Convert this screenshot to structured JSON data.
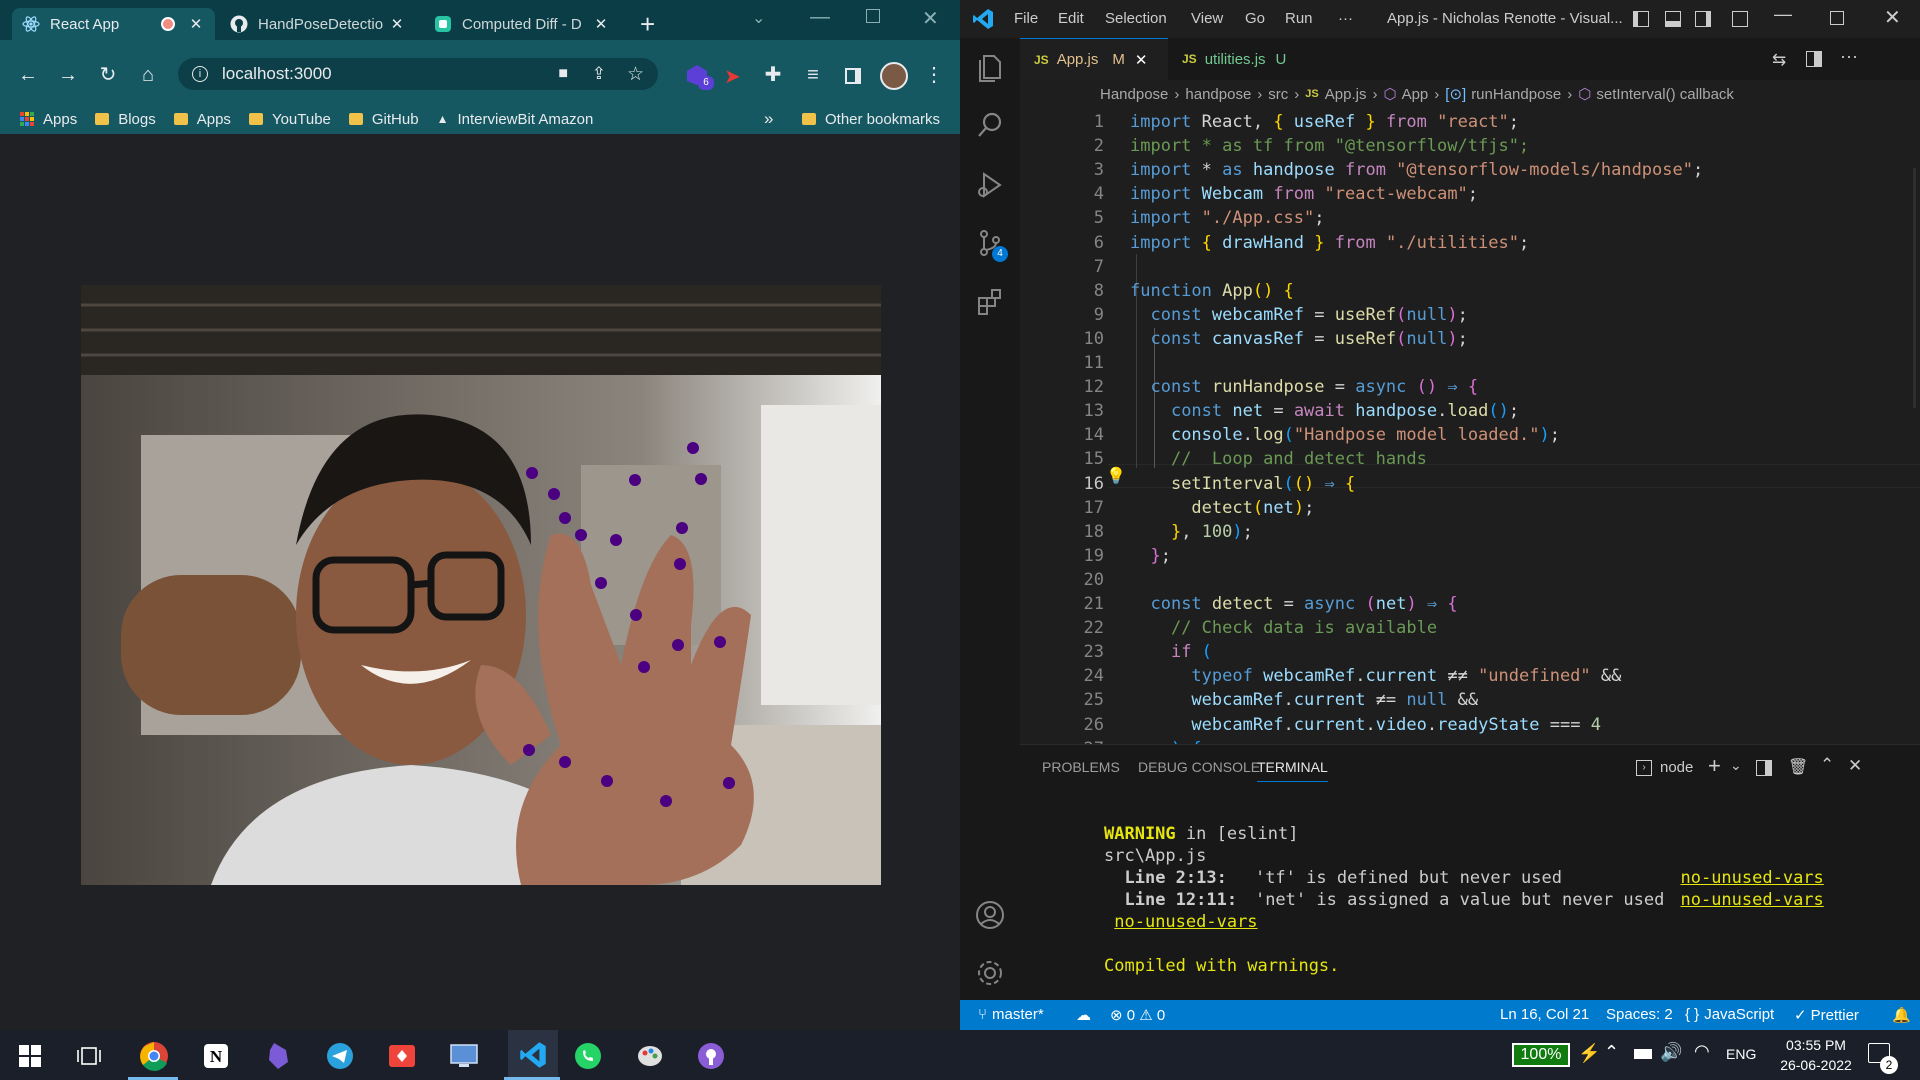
{
  "chrome": {
    "tabs": [
      {
        "label": "React App",
        "active": true
      },
      {
        "label": "HandPoseDetectio",
        "active": false
      },
      {
        "label": "Computed Diff - D",
        "active": false
      }
    ],
    "new_tab": "+",
    "address": "localhost:3000",
    "profile_badge": "6",
    "bookmarks": [
      "Apps",
      "Blogs",
      "Apps",
      "YouTube",
      "GitHub",
      "InterviewBit Amazon"
    ],
    "bookmarks_more": "»",
    "other_bookmarks": "Other bookmarks",
    "hand_keypoint_count": 21
  },
  "vscode": {
    "menu": [
      "File",
      "Edit",
      "Selection",
      "View",
      "Go",
      "Run",
      "···"
    ],
    "title": "App.js - Nicholas Renotte - Visual...",
    "tabs": [
      {
        "icon": "JS",
        "label": "App.js",
        "status": "M",
        "active": true
      },
      {
        "icon": "JS",
        "label": "utilities.js",
        "status": "U",
        "active": false
      }
    ],
    "breadcrumb": [
      "Handpose",
      "handpose",
      "src",
      "App.js",
      "App",
      "runHandpose",
      "setInterval() callback"
    ],
    "breadcrumb_js": "JS",
    "source_control_badge": "4",
    "code_lines": [
      [
        [
          "k",
          "import "
        ],
        [
          "w",
          "React, "
        ],
        [
          "y",
          "{"
        ],
        [
          "v",
          " useRef "
        ],
        [
          "y",
          "}"
        ],
        [
          "c",
          " from "
        ],
        [
          "s",
          "\"react\""
        ],
        [
          "w",
          ";"
        ]
      ],
      [
        [
          "g",
          "import * as tf from \"@tensorflow/tfjs\";"
        ]
      ],
      [
        [
          "k",
          "import "
        ],
        [
          "w",
          "* "
        ],
        [
          "k",
          "as "
        ],
        [
          "v",
          "handpose "
        ],
        [
          "c",
          "from "
        ],
        [
          "s",
          "\"@tensorflow-models/handpose\""
        ],
        [
          "w",
          ";"
        ]
      ],
      [
        [
          "k",
          "import "
        ],
        [
          "v",
          "Webcam "
        ],
        [
          "c",
          "from "
        ],
        [
          "s",
          "\"react-webcam\""
        ],
        [
          "w",
          ";"
        ]
      ],
      [
        [
          "k",
          "import "
        ],
        [
          "s",
          "\"./App.css\""
        ],
        [
          "w",
          ";"
        ]
      ],
      [
        [
          "k",
          "import "
        ],
        [
          "y",
          "{"
        ],
        [
          "v",
          " drawHand "
        ],
        [
          "y",
          "}"
        ],
        [
          "c",
          " from "
        ],
        [
          "s",
          "\"./utilities\""
        ],
        [
          "w",
          ";"
        ]
      ],
      [],
      [
        [
          "k",
          "function "
        ],
        [
          "f",
          "App"
        ],
        [
          "y",
          "() {"
        ]
      ],
      [
        [
          "w",
          "  "
        ],
        [
          "k",
          "const "
        ],
        [
          "v",
          "webcamRef "
        ],
        [
          "w",
          "= "
        ],
        [
          "f",
          "useRef"
        ],
        [
          "p",
          "("
        ],
        [
          "k",
          "null"
        ],
        [
          "p",
          ")"
        ],
        [
          "w",
          ";"
        ]
      ],
      [
        [
          "w",
          "  "
        ],
        [
          "k",
          "const "
        ],
        [
          "v",
          "canvasRef "
        ],
        [
          "w",
          "= "
        ],
        [
          "f",
          "useRef"
        ],
        [
          "p",
          "("
        ],
        [
          "k",
          "null"
        ],
        [
          "p",
          ")"
        ],
        [
          "w",
          ";"
        ]
      ],
      [],
      [
        [
          "w",
          "  "
        ],
        [
          "k",
          "const "
        ],
        [
          "f",
          "runHandpose "
        ],
        [
          "w",
          "= "
        ],
        [
          "k",
          "async "
        ],
        [
          "p",
          "() "
        ],
        [
          "k",
          "⇒ "
        ],
        [
          "p",
          "{"
        ]
      ],
      [
        [
          "w",
          "    "
        ],
        [
          "k",
          "const "
        ],
        [
          "v",
          "net "
        ],
        [
          "w",
          "= "
        ],
        [
          "c",
          "await "
        ],
        [
          "v",
          "handpose"
        ],
        [
          "w",
          "."
        ],
        [
          "f",
          "load"
        ],
        [
          "b",
          "()"
        ],
        [
          "w",
          ";"
        ]
      ],
      [
        [
          "w",
          "    "
        ],
        [
          "v",
          "console"
        ],
        [
          "w",
          "."
        ],
        [
          "f",
          "log"
        ],
        [
          "b",
          "("
        ],
        [
          "s",
          "\"Handpose model loaded.\""
        ],
        [
          "b",
          ")"
        ],
        [
          "w",
          ";"
        ]
      ],
      [
        [
          "w",
          "    "
        ],
        [
          "g",
          "//  Loop and detect hands"
        ]
      ],
      [
        [
          "w",
          "    "
        ],
        [
          "f",
          "setInterval"
        ],
        [
          "b",
          "("
        ],
        [
          "y",
          "() "
        ],
        [
          "k",
          "⇒ "
        ],
        [
          "y",
          "{"
        ]
      ],
      [
        [
          "w",
          "      "
        ],
        [
          "f",
          "detect"
        ],
        [
          "y",
          "("
        ],
        [
          "v",
          "net"
        ],
        [
          "y",
          ")"
        ],
        [
          "w",
          ";"
        ]
      ],
      [
        [
          "w",
          "    "
        ],
        [
          "y",
          "}"
        ],
        [
          "w",
          ", "
        ],
        [
          "n",
          "100"
        ],
        [
          "b",
          ")"
        ],
        [
          "w",
          ";"
        ]
      ],
      [
        [
          "w",
          "  "
        ],
        [
          "p",
          "}"
        ],
        [
          "w",
          ";"
        ]
      ],
      [],
      [
        [
          "w",
          "  "
        ],
        [
          "k",
          "const "
        ],
        [
          "f",
          "detect "
        ],
        [
          "w",
          "= "
        ],
        [
          "k",
          "async "
        ],
        [
          "p",
          "("
        ],
        [
          "v",
          "net"
        ],
        [
          "p",
          ") "
        ],
        [
          "k",
          "⇒ "
        ],
        [
          "p",
          "{"
        ]
      ],
      [
        [
          "w",
          "    "
        ],
        [
          "g",
          "// Check data is available"
        ]
      ],
      [
        [
          "w",
          "    "
        ],
        [
          "c",
          "if "
        ],
        [
          "b",
          "("
        ]
      ],
      [
        [
          "w",
          "      "
        ],
        [
          "k",
          "typeof "
        ],
        [
          "v",
          "webcamRef"
        ],
        [
          "w",
          "."
        ],
        [
          "v",
          "current "
        ],
        [
          "w",
          "≠≠ "
        ],
        [
          "s",
          "\"undefined\" "
        ],
        [
          "w",
          "&&"
        ]
      ],
      [
        [
          "w",
          "      "
        ],
        [
          "v",
          "webcamRef"
        ],
        [
          "w",
          "."
        ],
        [
          "v",
          "current "
        ],
        [
          "w",
          "≠= "
        ],
        [
          "k",
          "null "
        ],
        [
          "w",
          "&&"
        ]
      ],
      [
        [
          "w",
          "      "
        ],
        [
          "v",
          "webcamRef"
        ],
        [
          "w",
          "."
        ],
        [
          "v",
          "current"
        ],
        [
          "w",
          "."
        ],
        [
          "v",
          "video"
        ],
        [
          "w",
          "."
        ],
        [
          "v",
          "readyState "
        ],
        [
          "w",
          "=== "
        ],
        [
          "n",
          "4"
        ]
      ],
      [
        [
          "w",
          "    "
        ],
        [
          "b",
          ") {"
        ]
      ]
    ],
    "panel_tabs": [
      "PROBLEMS",
      "DEBUG CONSOLE",
      "TERMINAL"
    ],
    "terminal_shell": "node",
    "terminal": {
      "warning_label": "WARNING",
      "warning_rest": " in [eslint]",
      "file": "src\\App.js",
      "line1_loc": "Line 2:13:",
      "line1_msg": "  'tf' is defined but never used",
      "line1_rule": "no-unused-vars",
      "line2_loc": "Line 12:11:",
      "line2_msg": "  'net' is assigned a value but never used",
      "line2_rule": "no-unused-vars",
      "line3_rule": "no-unused-vars",
      "compiled": "Compiled with warnings."
    },
    "status": {
      "branch": "master*",
      "errors": "0",
      "warnings": "0",
      "position": "Ln 16, Col 21",
      "spaces": "Spaces: 2",
      "language": "JavaScript",
      "formatter": "Prettier"
    }
  },
  "taskbar": {
    "battery": "100%",
    "language": "ENG",
    "time": "03:55 PM",
    "date": "26-06-2022",
    "notifications": "2"
  }
}
